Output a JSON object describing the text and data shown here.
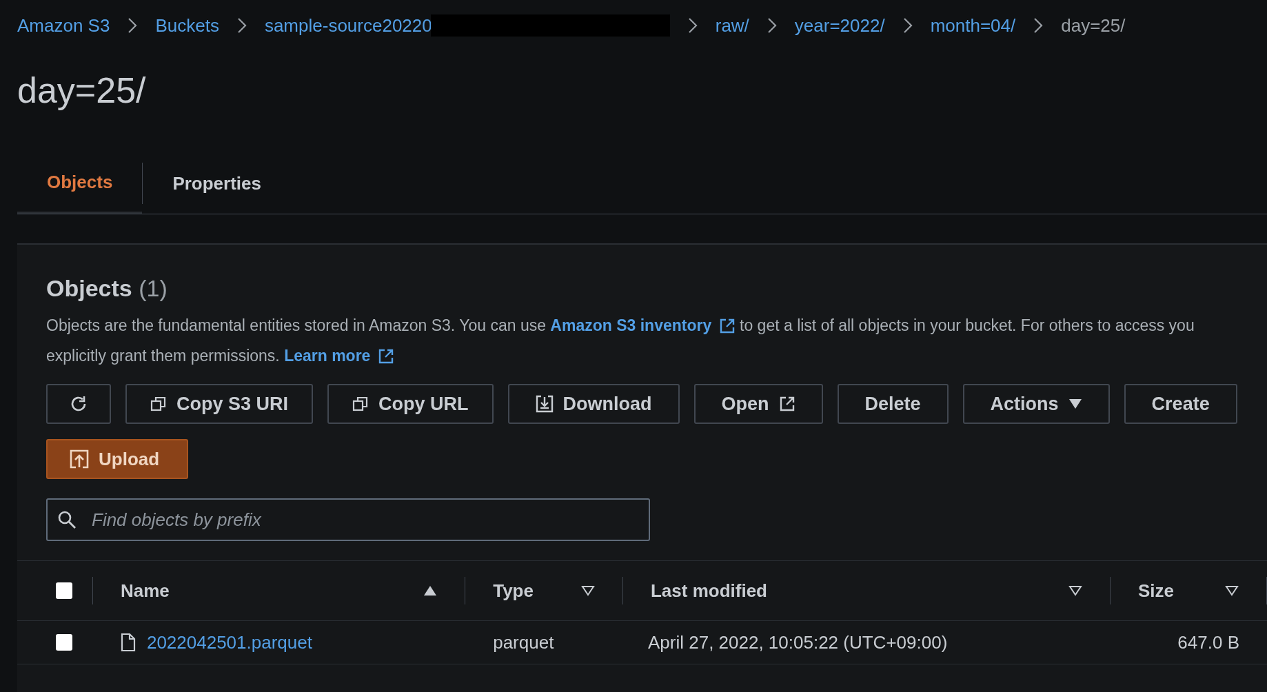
{
  "breadcrumbs": [
    {
      "label": "Amazon S3",
      "current": false,
      "redacted": false
    },
    {
      "label": "Buckets",
      "current": false,
      "redacted": false
    },
    {
      "label": "sample-source20220",
      "current": false,
      "redacted": true
    },
    {
      "label": "raw/",
      "current": false,
      "redacted": false
    },
    {
      "label": "year=2022/",
      "current": false,
      "redacted": false
    },
    {
      "label": "month=04/",
      "current": false,
      "redacted": false
    },
    {
      "label": "day=25/",
      "current": true,
      "redacted": false
    }
  ],
  "page_title": "day=25/",
  "tabs": [
    {
      "label": "Objects",
      "selected": true
    },
    {
      "label": "Properties",
      "selected": false
    }
  ],
  "objects_panel": {
    "heading": "Objects",
    "count": "(1)",
    "description": {
      "text_1": "Objects are the fundamental entities stored in Amazon S3. You can use",
      "link_1": "Amazon S3 inventory",
      "text_2": "to get a list of all objects in your bucket. For others to access you",
      "text_3": "explicitly grant them permissions.",
      "link_2": "Learn more"
    },
    "toolbar": [
      {
        "kind": "refresh"
      },
      {
        "kind": "copy",
        "label": "Copy S3 URI"
      },
      {
        "kind": "copy",
        "label": "Copy URL"
      },
      {
        "kind": "download",
        "label": "Download"
      },
      {
        "kind": "external",
        "label": "Open"
      },
      {
        "kind": "plain",
        "label": "Delete"
      },
      {
        "kind": "dropdown",
        "label": "Actions"
      },
      {
        "kind": "plain",
        "label": "Create"
      }
    ],
    "upload_button": "Upload",
    "search": {
      "placeholder": "Find objects by prefix"
    },
    "table": {
      "select_all": {
        "checked": false
      },
      "columns": [
        {
          "label": "Name",
          "sorted_ascending": true
        },
        {
          "label": "Type",
          "sorted_ascending": false
        },
        {
          "label": "Last modified",
          "sorted_ascending": false
        },
        {
          "label": "Size",
          "sorted_ascending": false
        }
      ],
      "rows": [
        {
          "checked": false,
          "name": "2022042501.parquet",
          "type": "parquet",
          "last_modified": "April 27, 2022, 10:05:22 (UTC+09:00)",
          "size": "647.0 B"
        }
      ]
    }
  }
}
